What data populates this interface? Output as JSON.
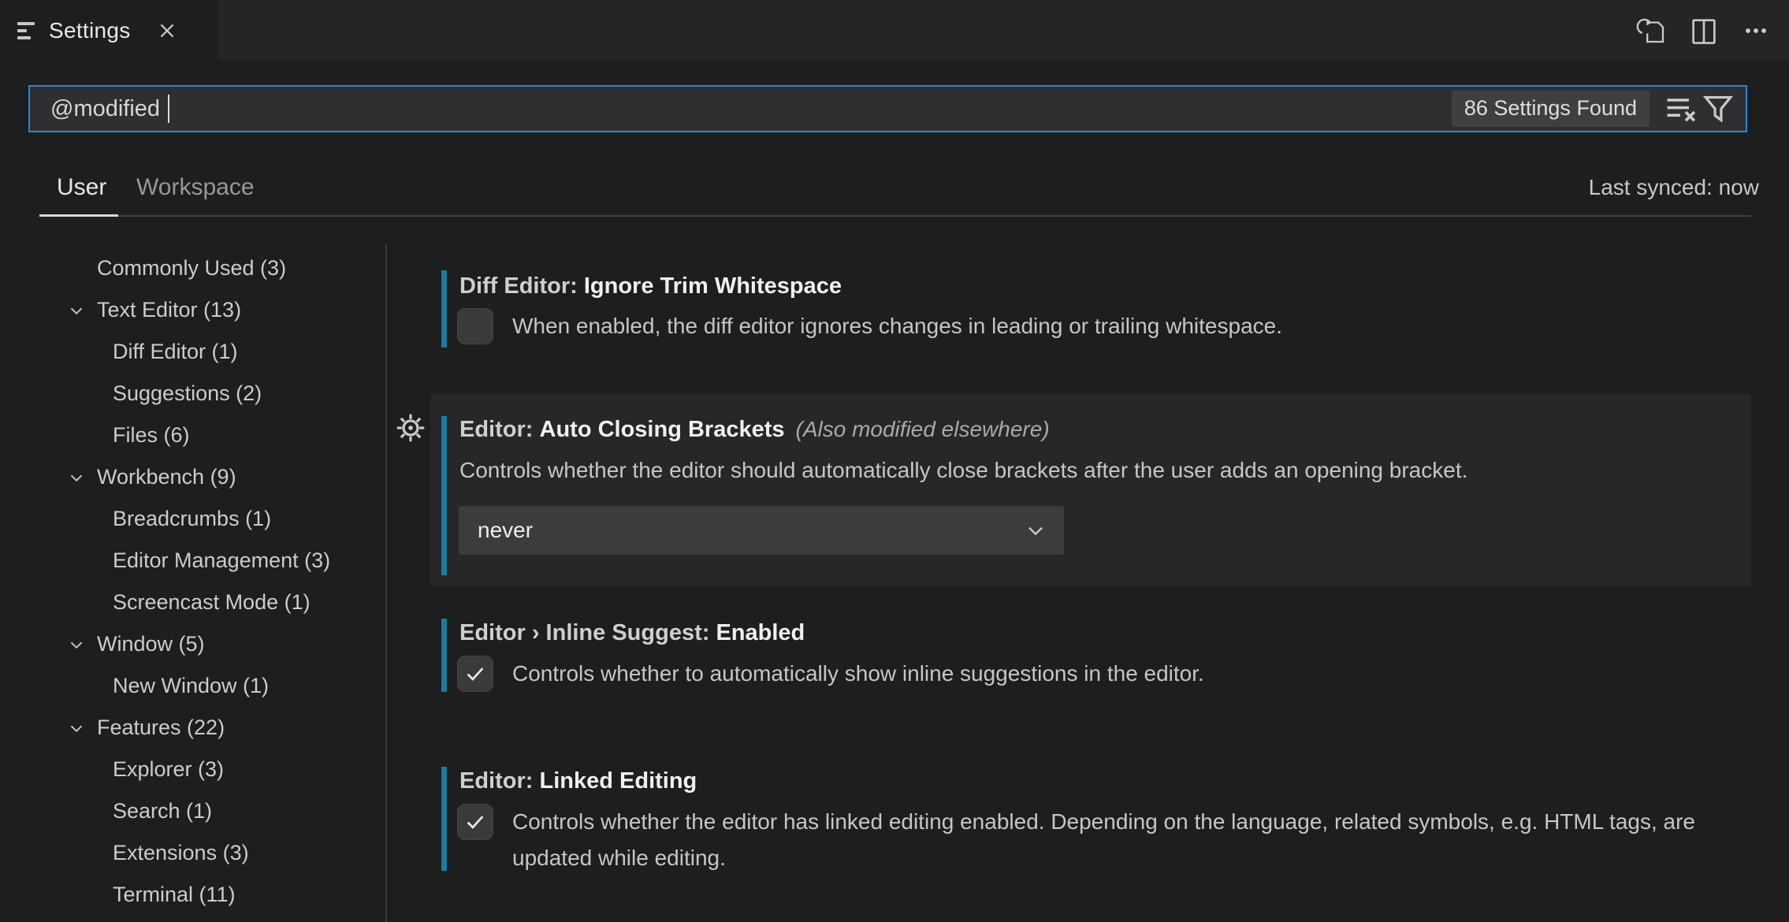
{
  "colors": {
    "page_bg": "#1e1e1e",
    "tabbar_bg": "#252526",
    "focus_border": "#2488d8",
    "modified_indicator": "#1a7ca1",
    "control_bg": "#3c3c3c"
  },
  "tab": {
    "title": "Settings"
  },
  "editor_actions": {
    "open_settings_json": "open-settings-json",
    "split_editor": "split-editor",
    "more_actions": "more-actions"
  },
  "search": {
    "query": "@modified",
    "results_badge": "86 Settings Found"
  },
  "scope": {
    "tabs": [
      {
        "label": "User",
        "active": true
      },
      {
        "label": "Workspace",
        "active": false
      }
    ],
    "sync_status": "Last synced: now"
  },
  "toc": [
    {
      "label": "Commonly Used",
      "count": 3,
      "level": 1,
      "chevron": false
    },
    {
      "label": "Text Editor",
      "count": 13,
      "level": 1,
      "chevron": true
    },
    {
      "label": "Diff Editor",
      "count": 1,
      "level": 2,
      "chevron": false
    },
    {
      "label": "Suggestions",
      "count": 2,
      "level": 2,
      "chevron": false
    },
    {
      "label": "Files",
      "count": 6,
      "level": 2,
      "chevron": false
    },
    {
      "label": "Workbench",
      "count": 9,
      "level": 1,
      "chevron": true
    },
    {
      "label": "Breadcrumbs",
      "count": 1,
      "level": 2,
      "chevron": false
    },
    {
      "label": "Editor Management",
      "count": 3,
      "level": 2,
      "chevron": false
    },
    {
      "label": "Screencast Mode",
      "count": 1,
      "level": 2,
      "chevron": false
    },
    {
      "label": "Window",
      "count": 5,
      "level": 1,
      "chevron": true
    },
    {
      "label": "New Window",
      "count": 1,
      "level": 2,
      "chevron": false
    },
    {
      "label": "Features",
      "count": 22,
      "level": 1,
      "chevron": true
    },
    {
      "label": "Explorer",
      "count": 3,
      "level": 2,
      "chevron": false
    },
    {
      "label": "Search",
      "count": 1,
      "level": 2,
      "chevron": false
    },
    {
      "label": "Extensions",
      "count": 3,
      "level": 2,
      "chevron": false
    },
    {
      "label": "Terminal",
      "count": 11,
      "level": 2,
      "chevron": false
    }
  ],
  "settings": [
    {
      "category": "Diff Editor: ",
      "name": "Ignore Trim Whitespace",
      "description": "When enabled, the diff editor ignores changes in leading or trailing whitespace.",
      "control": "checkbox",
      "checked": false
    },
    {
      "category": "Editor: ",
      "name": "Auto Closing Brackets",
      "note": "(Also modified elsewhere)",
      "description": "Controls whether the editor should automatically close brackets after the user adds an opening bracket.",
      "control": "select",
      "value": "never"
    },
    {
      "category": "Editor › Inline Suggest: ",
      "name": "Enabled",
      "description": "Controls whether to automatically show inline suggestions in the editor.",
      "control": "checkbox",
      "checked": true
    },
    {
      "category": "Editor: ",
      "name": "Linked Editing",
      "description": "Controls whether the editor has linked editing enabled. Depending on the language, related symbols, e.g. HTML tags, are updated while editing.",
      "control": "checkbox",
      "checked": true
    }
  ]
}
